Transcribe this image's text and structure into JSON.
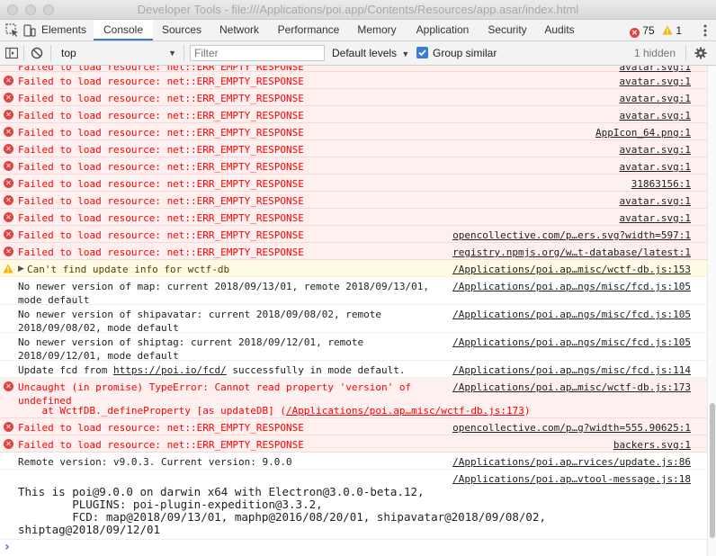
{
  "window": {
    "title": "Developer Tools - file:///Applications/poi.app/Contents/Resources/app.asar/index.html"
  },
  "tabs": [
    "Elements",
    "Console",
    "Sources",
    "Network",
    "Performance",
    "Memory",
    "Application",
    "Security",
    "Audits"
  ],
  "badges": {
    "errors": "75",
    "warnings": "1"
  },
  "toolbar": {
    "context": "top",
    "filter_placeholder": "Filter",
    "levels": "Default levels",
    "group_similar": "Group similar",
    "hidden": "1 hidden"
  },
  "messages": [
    {
      "type": "err",
      "text": "Failed to load resource: net::ERR_EMPTY_RESPONSE",
      "src": "avatar.svg:1"
    },
    {
      "type": "err",
      "text": "Failed to load resource: net::ERR_EMPTY_RESPONSE",
      "src": "avatar.svg:1"
    },
    {
      "type": "err",
      "text": "Failed to load resource: net::ERR_EMPTY_RESPONSE",
      "src": "avatar.svg:1"
    },
    {
      "type": "err",
      "text": "Failed to load resource: net::ERR_EMPTY_RESPONSE",
      "src": "avatar.svg:1"
    },
    {
      "type": "err",
      "text": "Failed to load resource: net::ERR_EMPTY_RESPONSE",
      "src": "AppIcon_64.png:1"
    },
    {
      "type": "err",
      "text": "Failed to load resource: net::ERR_EMPTY_RESPONSE",
      "src": "avatar.svg:1"
    },
    {
      "type": "err",
      "text": "Failed to load resource: net::ERR_EMPTY_RESPONSE",
      "src": "avatar.svg:1"
    },
    {
      "type": "err",
      "text": "Failed to load resource: net::ERR_EMPTY_RESPONSE",
      "src": "31863156:1"
    },
    {
      "type": "err",
      "text": "Failed to load resource: net::ERR_EMPTY_RESPONSE",
      "src": "avatar.svg:1"
    },
    {
      "type": "err",
      "text": "Failed to load resource: net::ERR_EMPTY_RESPONSE",
      "src": "avatar.svg:1"
    },
    {
      "type": "err",
      "text": "Failed to load resource: net::ERR_EMPTY_RESPONSE",
      "src": "opencollective.com/p…ers.svg?width=597:1"
    },
    {
      "type": "err",
      "text": "Failed to load resource: net::ERR_EMPTY_RESPONSE",
      "src": "registry.npmjs.org/w…t-database/latest:1"
    },
    {
      "type": "warn",
      "text": "Can't find update info for wctf-db",
      "src": "/Applications/poi.ap…misc/wctf-db.js:153"
    },
    {
      "type": "info",
      "text": "No newer version of map: current 2018/09/13/01, remote 2018/09/13/01,\nmode default",
      "src": "/Applications/poi.ap…ngs/misc/fcd.js:105"
    },
    {
      "type": "info",
      "text": "No newer version of shipavatar: current 2018/09/08/02, remote\n2018/09/08/02, mode default",
      "src": "/Applications/poi.ap…ngs/misc/fcd.js:105"
    },
    {
      "type": "info",
      "text": "No newer version of shiptag: current 2018/09/12/01, remote\n2018/09/12/01, mode default",
      "src": "/Applications/poi.ap…ngs/misc/fcd.js:105"
    },
    {
      "type": "info",
      "text_pre": "Update fcd from ",
      "text_link": "https://poi.io/fcd/",
      "text_post": " successfully in mode default.",
      "src": "/Applications/poi.ap…ngs/misc/fcd.js:114"
    },
    {
      "type": "err",
      "text": "Uncaught (in promise) TypeError: Cannot read property 'version' of\nundefined",
      "stack_pre": "    at WctfDB._defineProperty [as updateDB] (",
      "stack_link": "/Applications/poi.ap…misc/wctf-db.js:173",
      "stack_post": ")",
      "src": "/Applications/poi.ap…misc/wctf-db.js:173"
    },
    {
      "type": "err",
      "text": "Failed to load resource: net::ERR_EMPTY_RESPONSE",
      "src": "opencollective.com/p…g?width=555.90625:1"
    },
    {
      "type": "err",
      "text": "Failed to load resource: net::ERR_EMPTY_RESPONSE",
      "src": "backers.svg:1"
    },
    {
      "type": "info",
      "text": "Remote version: v9.0.3. Current version: 9.0.0",
      "src": "/Applications/poi.ap…rvices/update.js:86"
    },
    {
      "type": "info",
      "text": "",
      "src": "/Applications/poi.ap…vtool-message.js:18"
    }
  ],
  "banner": "This is poi@9.0.0 on darwin x64 with Electron@3.0.0-beta.12,\n        PLUGINS: poi-plugin-expedition@3.3.2,\n        FCD: map@2018/09/13/01, maphp@2016/08/20/01, shipavatar@2018/09/08/02,\nshiptag@2018/09/12/01",
  "prompt": "›",
  "colors": {
    "error": "#ff0000",
    "error_bg": "#fff0f0",
    "warn_bg": "#fffbe5",
    "accent": "#3a7bd5"
  }
}
